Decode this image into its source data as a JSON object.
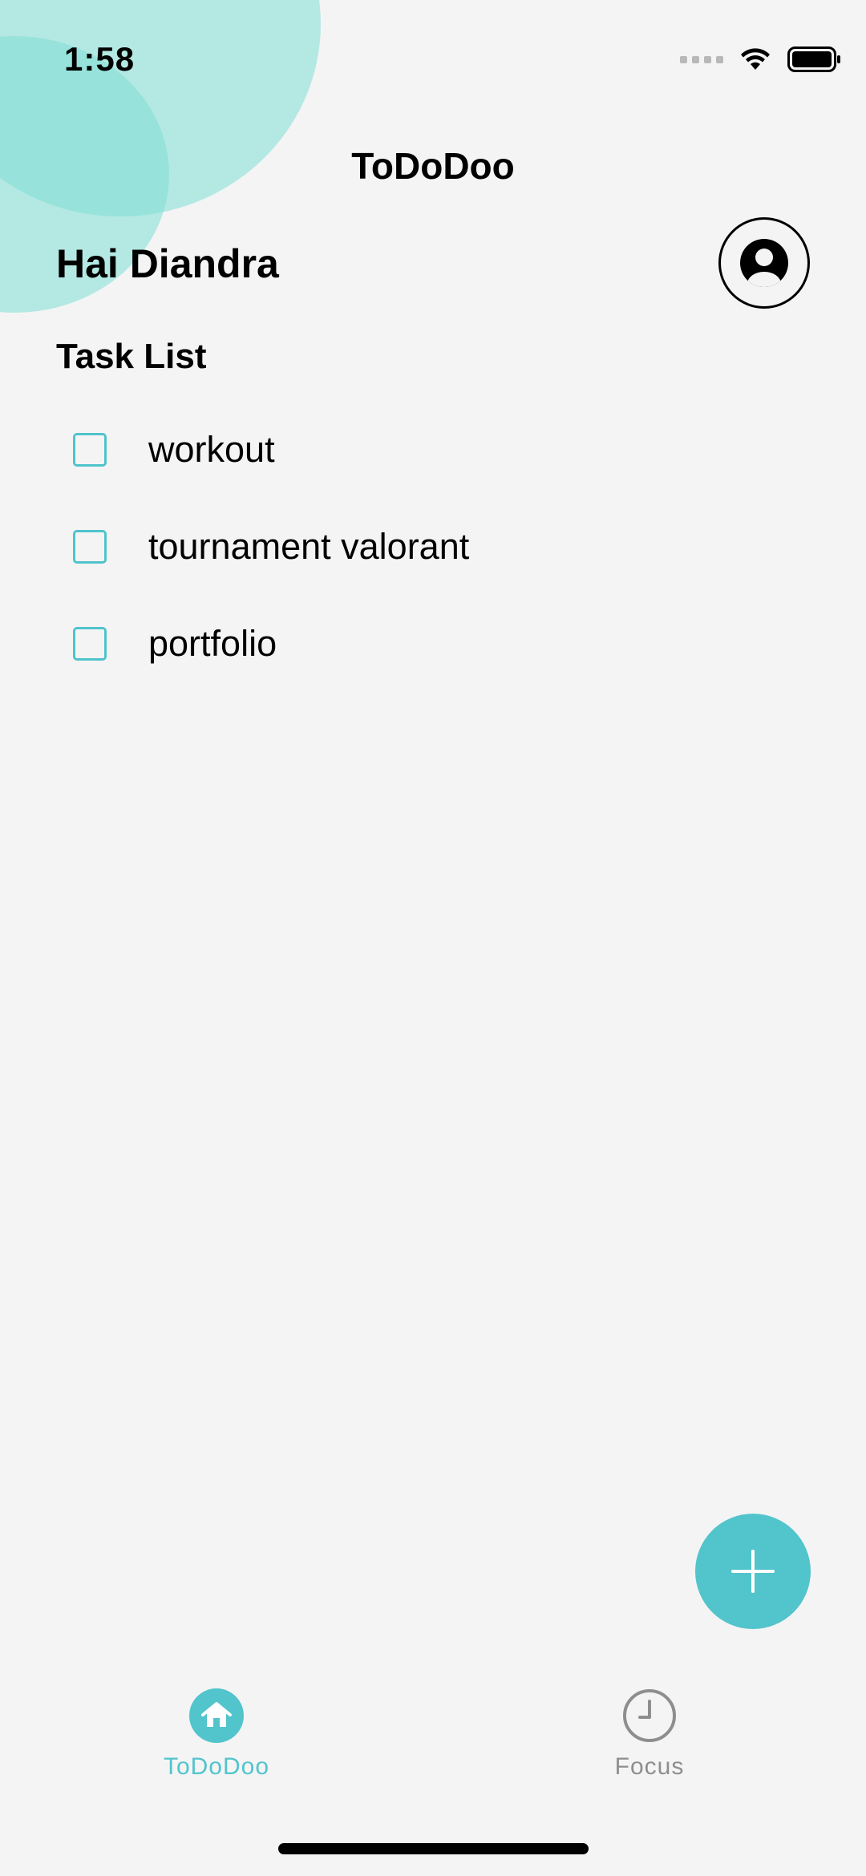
{
  "status_bar": {
    "time": "1:58",
    "icons": [
      "signal-icon",
      "wifi-icon",
      "battery-icon"
    ]
  },
  "header": {
    "app_title": "ToDoDoo",
    "greeting": "Hai Diandra",
    "profile_icon": "user-circle-icon"
  },
  "tasks": {
    "section_title": "Task List",
    "items": [
      {
        "label": "workout",
        "checked": false
      },
      {
        "label": "tournament valorant",
        "checked": false
      },
      {
        "label": "portfolio",
        "checked": false
      }
    ]
  },
  "fab": {
    "icon": "plus-icon"
  },
  "tabbar": {
    "tabs": [
      {
        "label": "ToDoDoo",
        "icon": "home-icon",
        "active": true
      },
      {
        "label": "Focus",
        "icon": "clock-icon",
        "active": false
      }
    ]
  },
  "colors": {
    "accent": "#52c4cc",
    "background": "#f4f4f4",
    "blob": "#7fded6",
    "inactive": "#8e8e8e"
  }
}
